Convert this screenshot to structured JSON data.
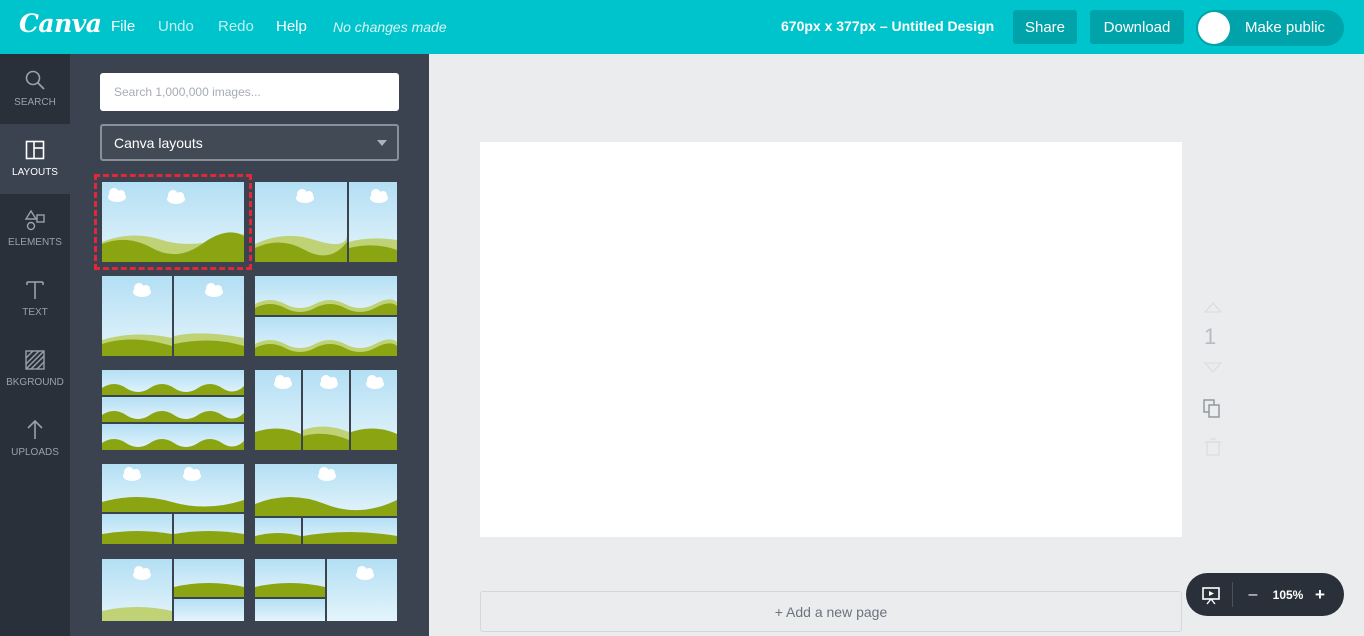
{
  "app": {
    "logo": "Canva"
  },
  "menu": {
    "file": "File",
    "undo": "Undo",
    "redo": "Redo",
    "help": "Help",
    "status": "No changes made"
  },
  "design": {
    "title": "670px x 377px – Untitled Design"
  },
  "toolbar": {
    "share": "Share",
    "download": "Download",
    "make_public": "Make public"
  },
  "rail": {
    "items": [
      {
        "label": "SEARCH",
        "icon": "search-icon"
      },
      {
        "label": "LAYOUTS",
        "icon": "layouts-icon"
      },
      {
        "label": "ELEMENTS",
        "icon": "elements-icon"
      },
      {
        "label": "TEXT",
        "icon": "text-icon"
      },
      {
        "label": "BKGROUND",
        "icon": "background-icon"
      },
      {
        "label": "UPLOADS",
        "icon": "upload-icon"
      }
    ]
  },
  "panel": {
    "search_placeholder": "Search 1,000,000 images...",
    "select_value": "Canva layouts"
  },
  "canvas": {
    "page_number": "1",
    "add_page": "+ Add a new page"
  },
  "zoom": {
    "level": "105%",
    "minus": "–",
    "plus": "+"
  },
  "colors": {
    "accent": "#00c4cc",
    "accent_dark": "#00a3aa",
    "rail": "#293039",
    "panel": "#3b4350",
    "sky": "#c9e8f7",
    "hill": "#8aa511",
    "hill_light": "#bfd275",
    "selection": "#e0283a"
  }
}
